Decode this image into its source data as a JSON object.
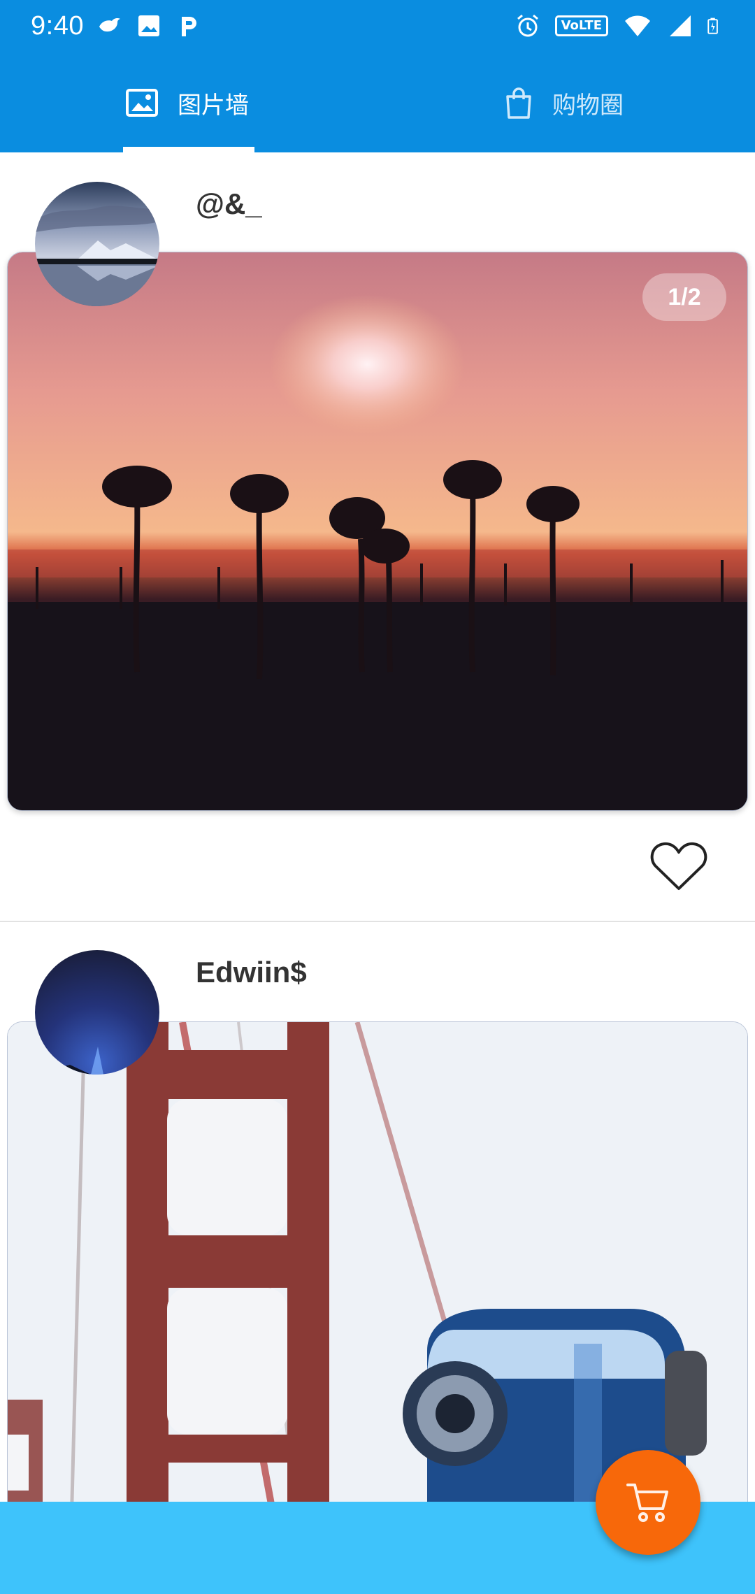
{
  "status_bar": {
    "time": "9:40",
    "left_icons": [
      "bird-notification-icon",
      "image-notification-icon",
      "p-app-icon"
    ],
    "right_icons": [
      "alarm-icon",
      "volte-badge",
      "wifi-icon",
      "signal-icon",
      "battery-charging-icon"
    ],
    "volte_label": "VoLTE"
  },
  "tabs": [
    {
      "label": "图片墙",
      "icon": "image-icon",
      "active": true
    },
    {
      "label": "购物圈",
      "icon": "shopping-bag-icon",
      "active": false
    }
  ],
  "posts": [
    {
      "username": "@&_",
      "page_indicator": "1/2",
      "liked": false,
      "avatar": "mountain-lake-night",
      "photo": "palm-trees-sunset-beach"
    },
    {
      "username": "Edwiin$",
      "avatar": "blue-night-sky",
      "photo": "golden-gate-bridge-viewer"
    }
  ],
  "fab": {
    "icon": "shopping-cart-icon"
  },
  "colors": {
    "primary": "#0a8de0",
    "bottom_bar": "#3ec3fb",
    "fab": "#f7680a",
    "username_text": "#333333"
  }
}
